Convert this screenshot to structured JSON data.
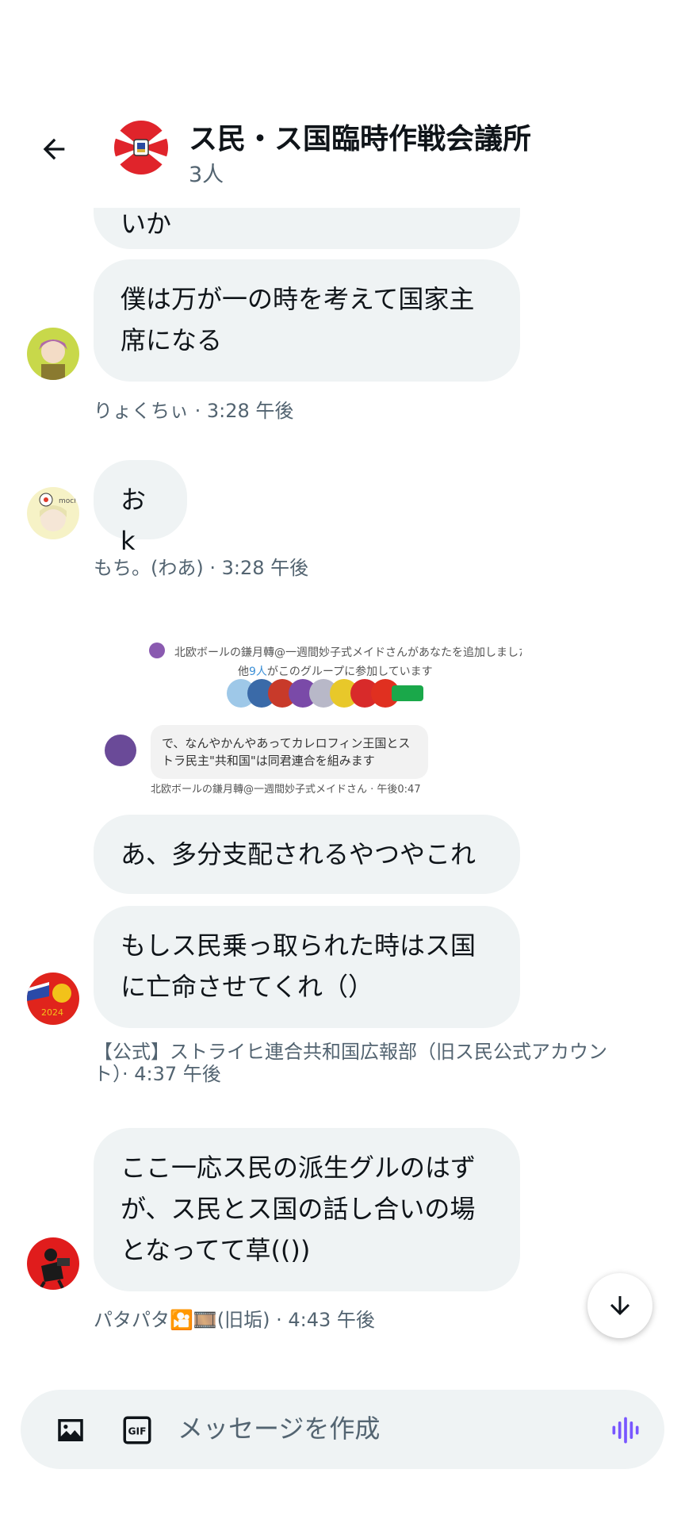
{
  "header": {
    "title": "ス民・ス国臨時作戦会議所",
    "members": "3人"
  },
  "messages": [
    {
      "text": "いか"
    },
    {
      "text": "僕は万が一の時を考えて国家主席になる",
      "meta": "りょくちぃ · 3:28 午後"
    },
    {
      "text": "おk",
      "meta": "もち。(わあ) · 3:28 午後"
    },
    {
      "text": "あ、多分支配されるやつやこれ"
    },
    {
      "text": "もしス民乗っ取られた時はス国に亡命させてくれ（）",
      "meta": "【公式】ストライヒ連合共和国広報部（旧ス民公式アカウント）· 4:37 午後"
    },
    {
      "text": "ここ一応ス民の派生グルのはずが、ス民とス国の話し合いの場となってて草(())",
      "meta": "パタパタ🎦🎞️(旧垢) · 4:43 午後"
    }
  ],
  "shared_image": {
    "added_line": "北欧ボールの鎌月轉@一週間妙子式メイドさんがあなたを追加しました",
    "members_line_prefix": "他",
    "members_line_count": "9人",
    "members_line_suffix": "がこのグループに参加しています",
    "bubble_text": "で、なんやかんやあってカレロフィン王国とストラ民主\"共和国\"は同君連合を組みます",
    "meta": "北欧ボールの鎌月轉@一週間妙子式メイドさん · 午後0:47"
  },
  "composer": {
    "placeholder": "メッセージを作成"
  },
  "colors": {
    "bubble": "#eff3f4",
    "meta_text": "#536471",
    "voice_accent": "#7856ff"
  }
}
